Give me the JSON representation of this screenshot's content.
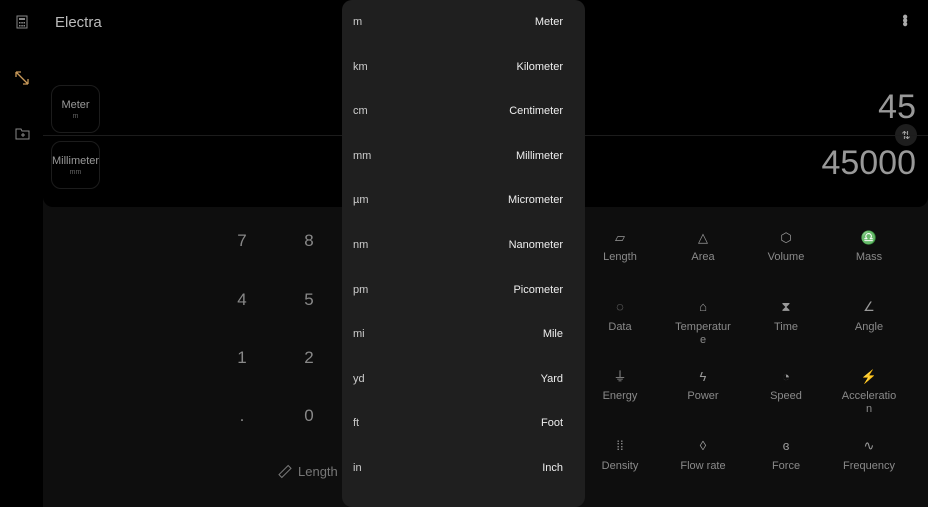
{
  "app": {
    "title": "Electra"
  },
  "sidebar": {
    "items": [
      {
        "icon": "calculator-icon"
      },
      {
        "icon": "unit-convert-icon",
        "active": true,
        "color": "#c99a5a"
      },
      {
        "icon": "folder-add-icon"
      }
    ]
  },
  "converter": {
    "from": {
      "name": "Meter",
      "symbol": "m",
      "value": "45"
    },
    "to": {
      "name": "Millimeter",
      "symbol": "mm",
      "value": "45000"
    }
  },
  "keypad": {
    "keys": [
      "7",
      "8",
      "4",
      "5",
      "1",
      "2",
      ".",
      "0"
    ],
    "category_button": "Length"
  },
  "unit_menu": [
    {
      "abbr": "m",
      "name": "Meter"
    },
    {
      "abbr": "km",
      "name": "Kilometer"
    },
    {
      "abbr": "cm",
      "name": "Centimeter"
    },
    {
      "abbr": "mm",
      "name": "Millimeter"
    },
    {
      "abbr": "µm",
      "name": "Micrometer"
    },
    {
      "abbr": "nm",
      "name": "Nanometer"
    },
    {
      "abbr": "pm",
      "name": "Picometer"
    },
    {
      "abbr": "mi",
      "name": "Mile"
    },
    {
      "abbr": "yd",
      "name": "Yard"
    },
    {
      "abbr": "ft",
      "name": "Foot"
    },
    {
      "abbr": "in",
      "name": "Inch"
    }
  ],
  "categories": [
    {
      "label": "Length",
      "icon": "ruler-icon"
    },
    {
      "label": "Area",
      "icon": "triangle-icon"
    },
    {
      "label": "Volume",
      "icon": "cube-icon"
    },
    {
      "label": "Mass",
      "icon": "weight-icon"
    },
    {
      "label": "Data",
      "icon": "data-usage-icon"
    },
    {
      "label": "Temperature",
      "icon": "thermostat-icon"
    },
    {
      "label": "Time",
      "icon": "hourglass-icon"
    },
    {
      "label": "Angle",
      "icon": "angle-icon"
    },
    {
      "label": "Energy",
      "icon": "plug-icon"
    },
    {
      "label": "Power",
      "icon": "bolt-icon"
    },
    {
      "label": "Speed",
      "icon": "speedometer-icon"
    },
    {
      "label": "Acceleration",
      "icon": "running-icon"
    },
    {
      "label": "Density",
      "icon": "grid-dots-icon"
    },
    {
      "label": "Flow rate",
      "icon": "drop-icon"
    },
    {
      "label": "Force",
      "icon": "muscle-icon"
    },
    {
      "label": "Frequency",
      "icon": "sine-wave-icon"
    }
  ]
}
